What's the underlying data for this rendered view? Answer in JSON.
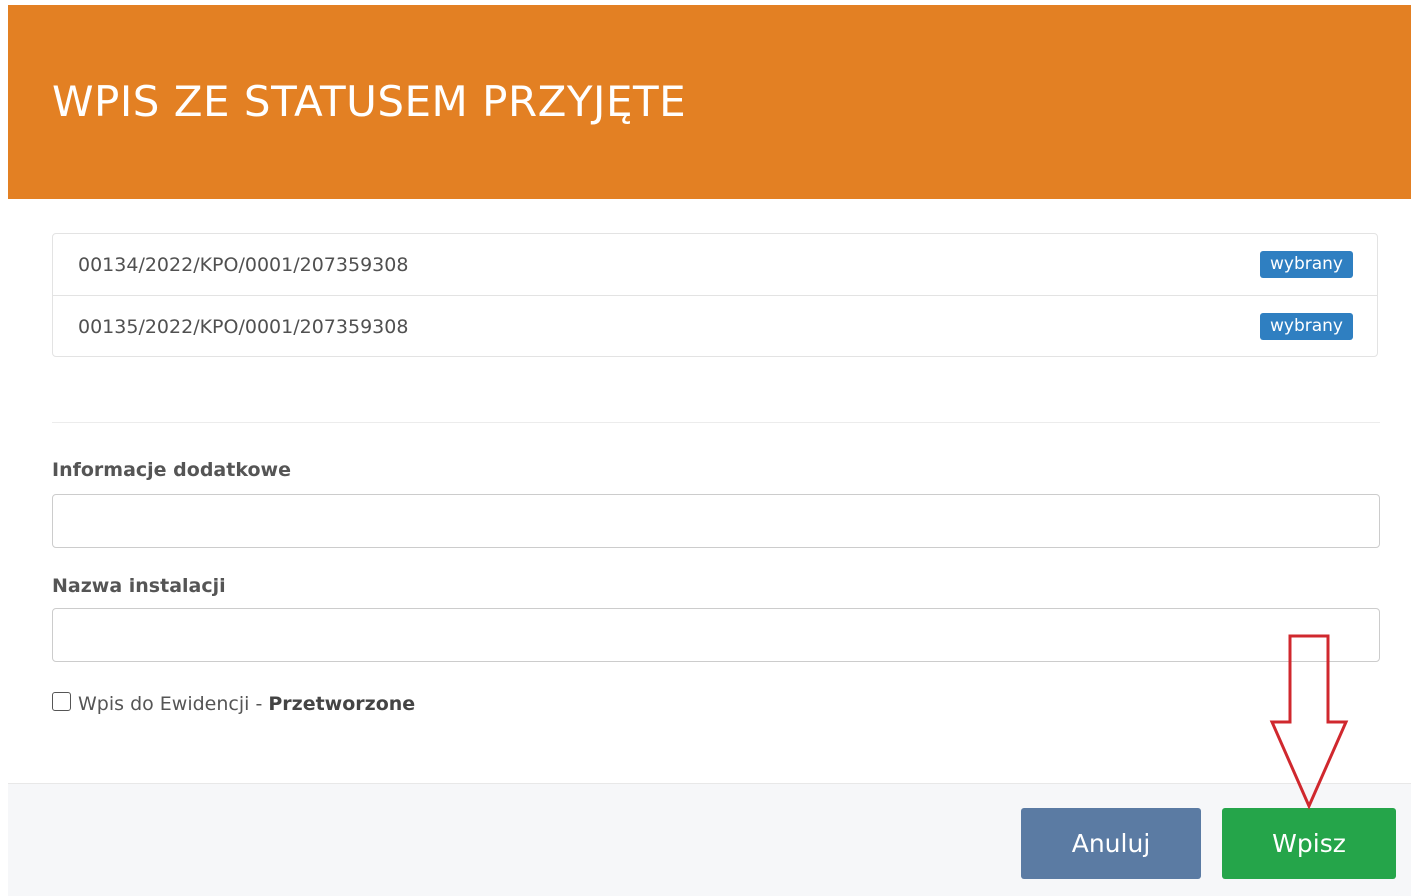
{
  "dialog": {
    "title": "WPIS ZE STATUSEM PRZYJĘTE"
  },
  "list": {
    "items": [
      {
        "label": "00134/2022/KPO/0001/207359308",
        "badge": "wybrany"
      },
      {
        "label": "00135/2022/KPO/0001/207359308",
        "badge": "wybrany"
      }
    ]
  },
  "form": {
    "additional_info": {
      "label": "Informacje dodatkowe",
      "value": ""
    },
    "installation_name": {
      "label": "Nazwa instalacji",
      "value": ""
    },
    "checkbox": {
      "checked": false,
      "label_prefix": "Wpis do Ewidencji - ",
      "label_bold": "Przetworzone"
    }
  },
  "footer": {
    "cancel_label": "Anuluj",
    "submit_label": "Wpisz"
  },
  "colors": {
    "header": "#e38023",
    "badge": "#2f7fc1",
    "cancel": "#5b7ba3",
    "submit": "#25a54a",
    "arrow": "#d0282e"
  },
  "icons": {
    "annotation": "down-arrow-icon"
  }
}
